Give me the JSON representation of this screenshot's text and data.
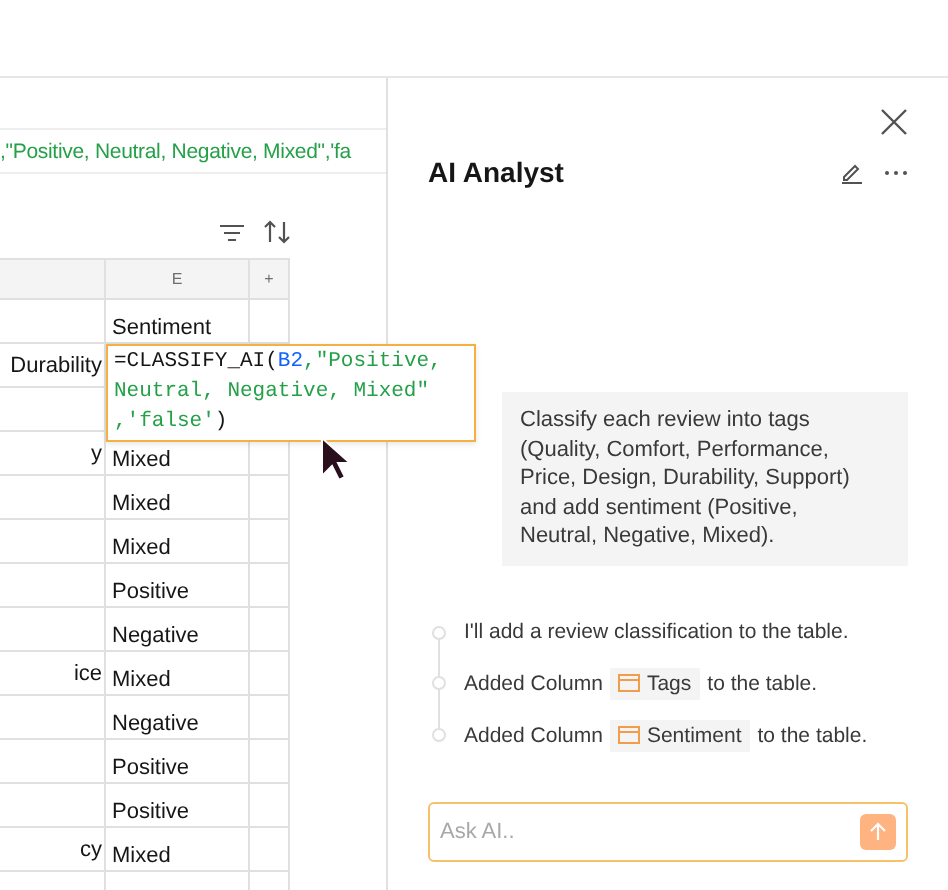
{
  "sheet": {
    "formula_bar": ",\"Positive, Neutral, Negative, Mixed\",'fa",
    "columns": [
      {
        "label": "E"
      },
      {
        "label": "+"
      }
    ],
    "rows": [
      {
        "e": "Sentiment"
      },
      {
        "d": "Durability"
      },
      {},
      {
        "d": "y",
        "e": "Mixed"
      },
      {
        "e": "Mixed"
      },
      {
        "e": "Mixed"
      },
      {
        "e": "Positive"
      },
      {
        "e": "Negative"
      },
      {
        "d": "ice",
        "e": "Mixed"
      },
      {
        "e": "Negative"
      },
      {
        "e": "Positive"
      },
      {
        "e": "Positive"
      },
      {
        "d": "cy",
        "e": "Mixed"
      },
      {}
    ],
    "formula_popup": {
      "lines": [
        [
          {
            "kind": "plain",
            "text": "=CLASSIFY_AI("
          },
          {
            "kind": "ref",
            "text": "B2"
          },
          {
            "kind": "string",
            "text": ",\"Positive,"
          }
        ],
        [
          {
            "kind": "string",
            "text": "Neutral, Negative, Mixed\""
          }
        ],
        [
          {
            "kind": "string",
            "text": ",'false'"
          },
          {
            "kind": "plain",
            "text": ")"
          }
        ]
      ]
    }
  },
  "panel": {
    "title": "AI Analyst",
    "user_message": "Classify each review into tags (Quality, Comfort, Performance, Price, Design, Durability, Support) and add sentiment (Positive, Neutral, Negative, Mixed).",
    "steps": [
      {
        "kind": "text",
        "text": "I'll add a review classification to the table."
      },
      {
        "kind": "column",
        "before": "Added Column",
        "chip": "Tags",
        "after": "to the table."
      },
      {
        "kind": "column",
        "before": "Added Column",
        "chip": "Sentiment",
        "after": "to the table."
      }
    ],
    "input": {
      "placeholder": "Ask AI.."
    }
  }
}
